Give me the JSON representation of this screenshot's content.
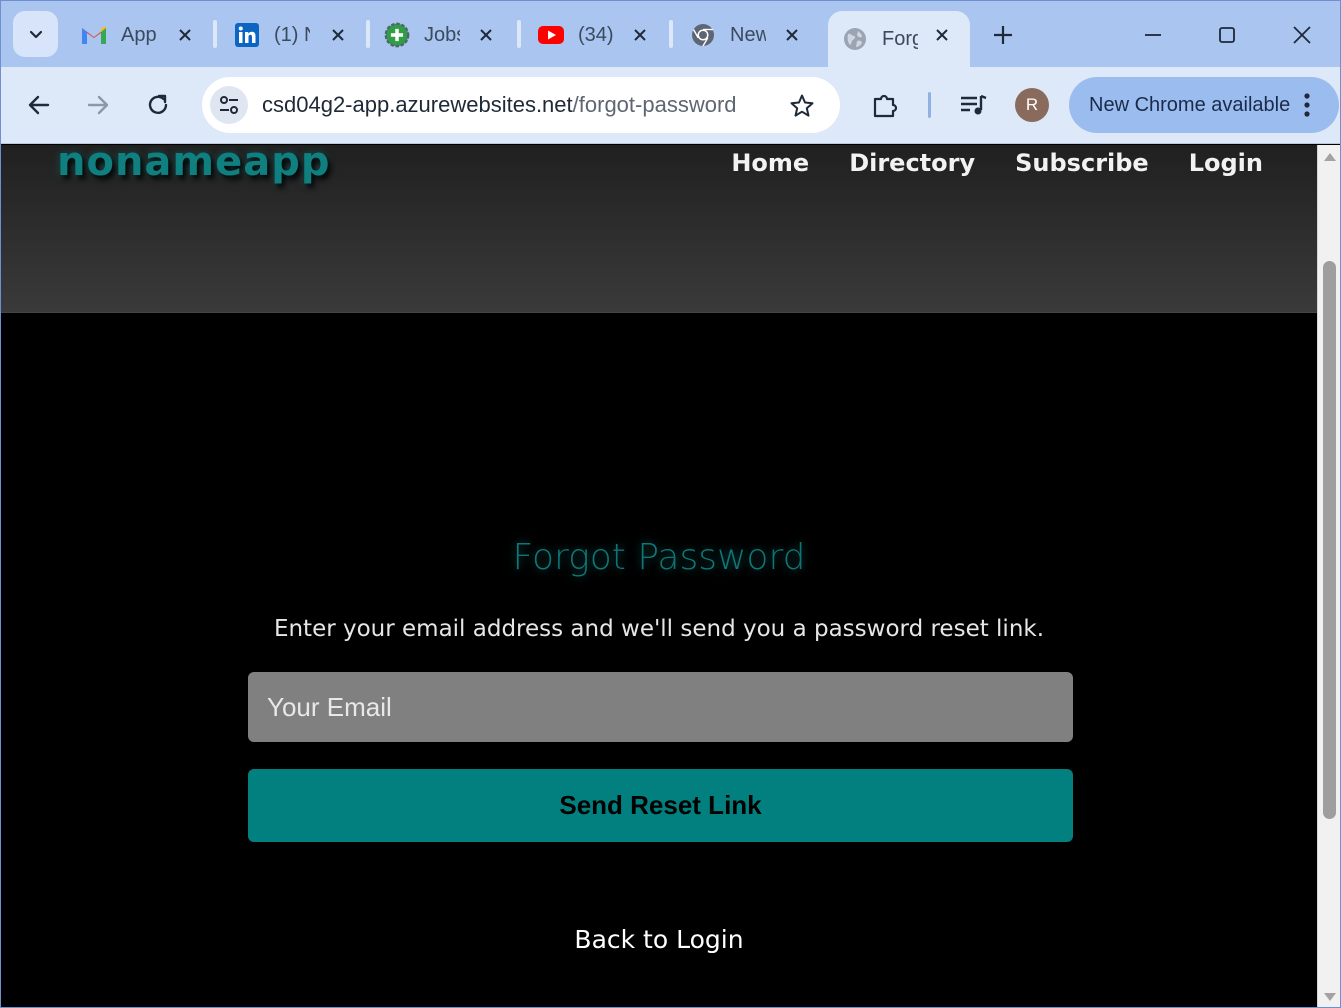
{
  "browser": {
    "tabs": [
      {
        "title": "App",
        "icon": "gmail-icon"
      },
      {
        "title": "(1) N",
        "icon": "linkedin-icon"
      },
      {
        "title": "Jobs",
        "icon": "jobs-site-icon"
      },
      {
        "title": "(34)",
        "icon": "youtube-icon"
      },
      {
        "title": "New",
        "icon": "chrome-icon"
      },
      {
        "title": "Forg",
        "icon": "globe-icon",
        "active": true
      }
    ],
    "url_host": "csd04g2-app.azurewebsites.net",
    "url_path": "/forgot-password",
    "profile_initial": "R",
    "update_label": "New Chrome available"
  },
  "site": {
    "logo": "nonameapp",
    "nav": [
      "Home",
      "Directory",
      "Subscribe",
      "Login"
    ]
  },
  "form": {
    "title": "Forgot Password",
    "description": "Enter your email address and we'll send you a password reset link.",
    "email_placeholder": "Your Email",
    "submit_label": "Send Reset Link",
    "back_label": "Back to Login"
  },
  "colors": {
    "accent": "#028080",
    "title": "#0e7676",
    "input_bg": "#808080"
  }
}
